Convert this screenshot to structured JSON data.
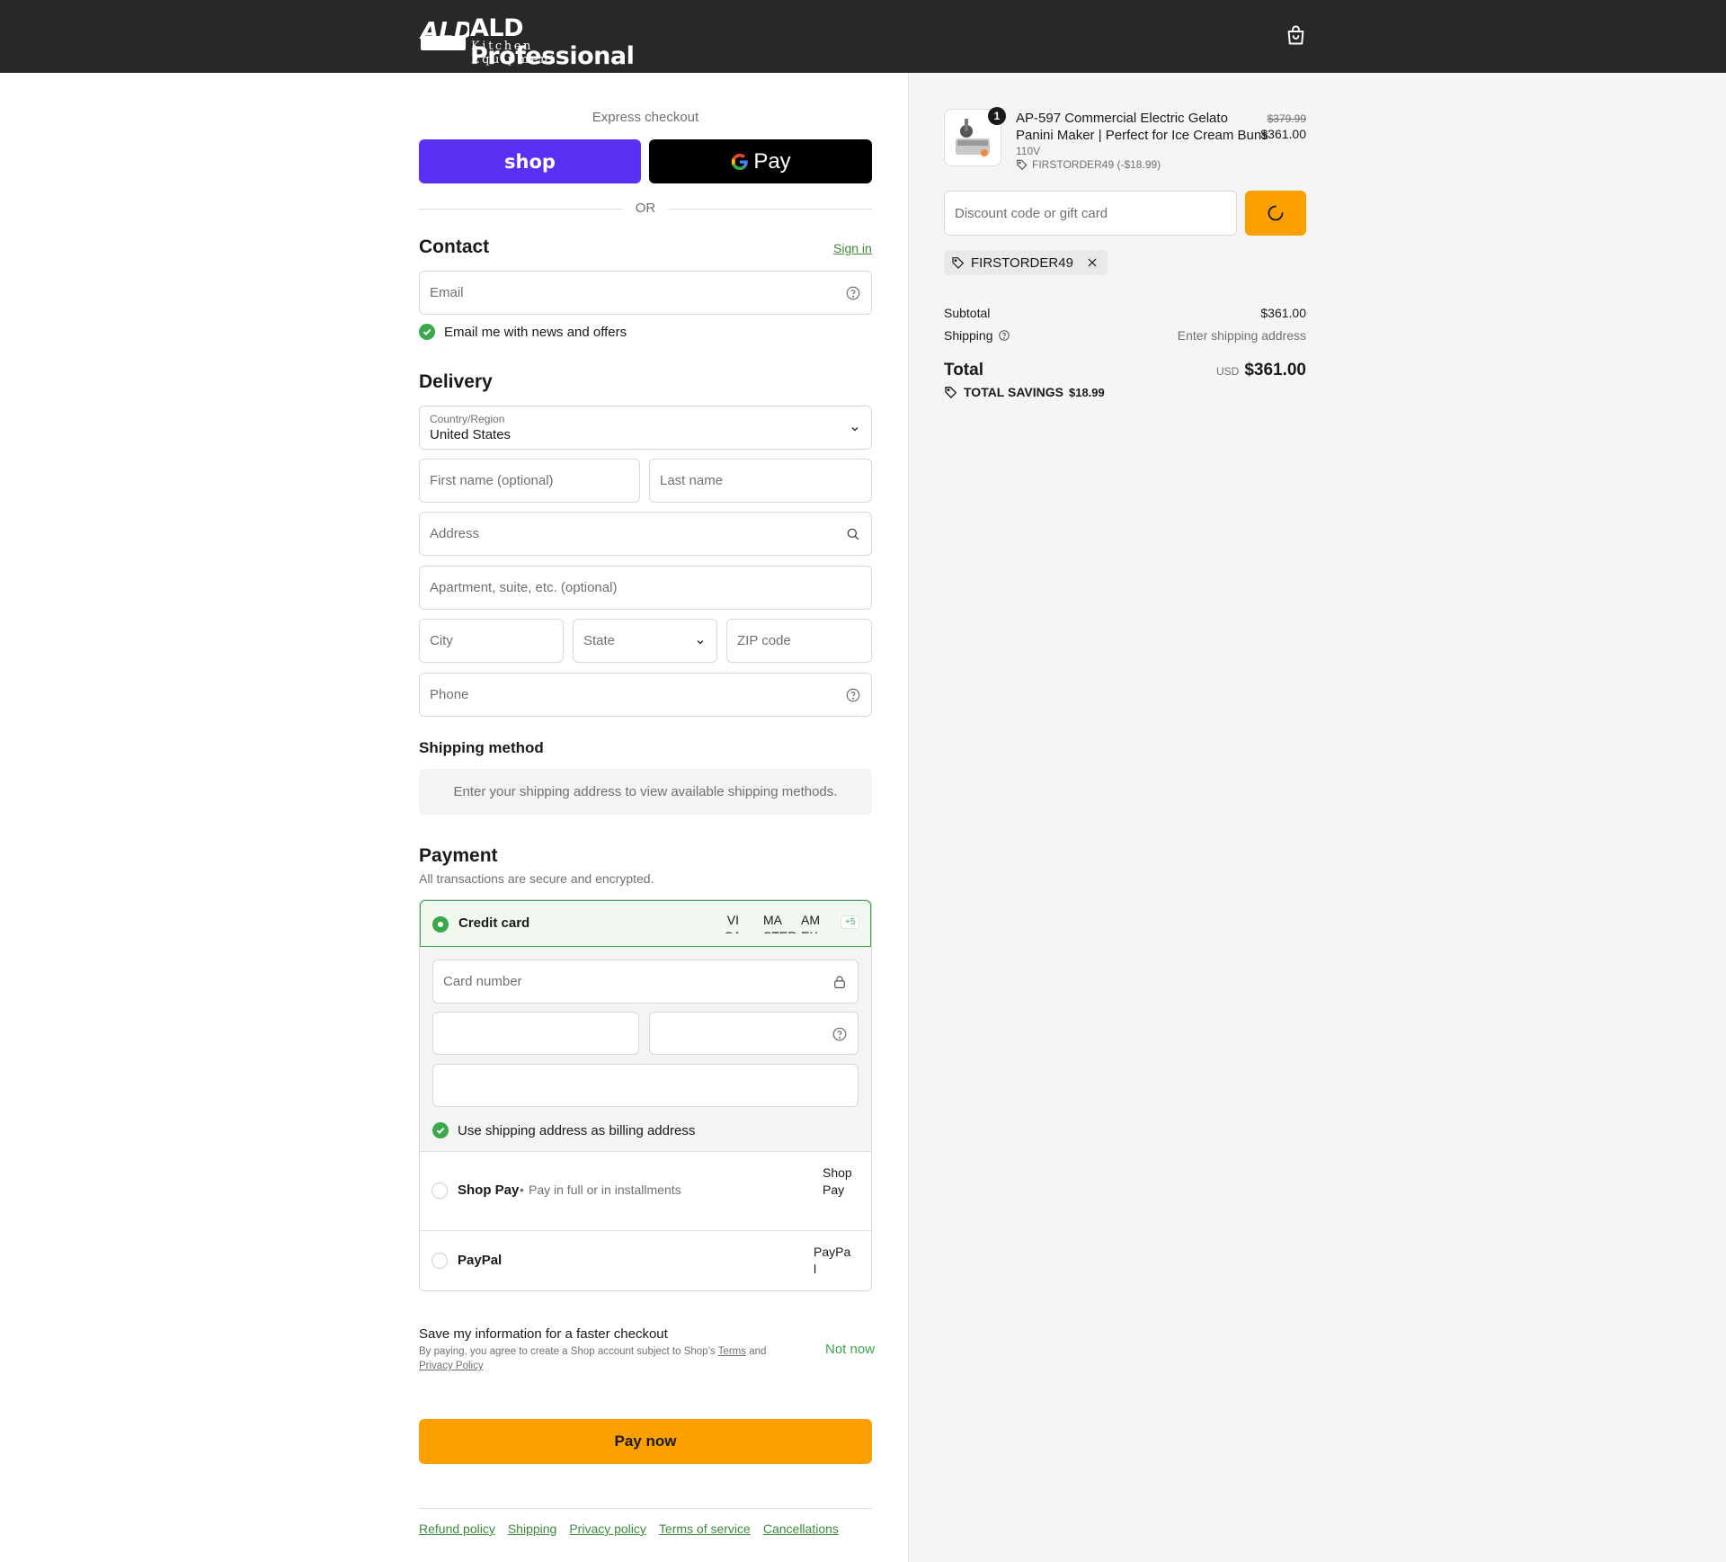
{
  "header": {
    "logo_top": "ALD Professional",
    "logo_mark": "ALD",
    "logo_bottom": "Kitchen Equipment",
    "cart_icon": "shopping-bag-icon"
  },
  "express": {
    "title": "Express checkout",
    "shop_label": "shop",
    "gpay_label": "Pay",
    "or_label": "OR"
  },
  "contact": {
    "title": "Contact",
    "sign_in": "Sign in",
    "email_placeholder": "Email",
    "news_label": "Email me with news and offers"
  },
  "delivery": {
    "title": "Delivery",
    "country_label": "Country/Region",
    "country_value": "United States",
    "first_name_placeholder": "First name (optional)",
    "last_name_placeholder": "Last name",
    "address_placeholder": "Address",
    "apartment_placeholder": "Apartment, suite, etc. (optional)",
    "city_placeholder": "City",
    "state_label": "State",
    "zip_placeholder": "ZIP code",
    "phone_placeholder": "Phone"
  },
  "shipping_method": {
    "title": "Shipping method",
    "notice": "Enter your shipping address to view available shipping methods."
  },
  "payment": {
    "title": "Payment",
    "subtitle": "All transactions are secure and encrypted.",
    "credit_card_label": "Credit card",
    "brand_visa": "VISA",
    "brand_master": "MASTER",
    "brand_amex": "AMEX",
    "brand_visa_alt": " VI SA",
    "brand_master_alt": "MA STER",
    "brand_amex_alt": "AM EX",
    "more_brands": "+5",
    "card_number_placeholder": "Card number",
    "billing_label": "Use shipping address as billing address",
    "shop_pay_label": "Shop Pay",
    "shop_pay_desc": "Pay in full or in installments",
    "shop_pay_alt": "Shop Pay",
    "paypal_label": "PayPal",
    "paypal_alt": "PayPal"
  },
  "save_info": {
    "title": "Save my information for a faster checkout",
    "desc_prefix": "By paying, you agree to create a Shop account subject to Shop’s",
    "terms": "Terms",
    "and": "and",
    "privacy": "Privacy Policy",
    "not_now": "Not now"
  },
  "pay_now": "Pay now",
  "footer_links": [
    "Refund policy",
    "Shipping",
    "Privacy policy",
    "Terms of service",
    "Cancellations"
  ],
  "summary": {
    "quantity": "1",
    "product_name_line1": "AP-597 Commercial Electric Gelato",
    "product_name_line2": "Panini Maker | Perfect for Ice Cream Buns",
    "variant": "110V",
    "product_discount": "FIRSTORDER49 (-$18.99)",
    "original_price": "$379.99",
    "price": "$361.00",
    "discount_placeholder": "Discount code or gift card",
    "applied_code": "FIRSTORDER49",
    "subtotal_label": "Subtotal",
    "subtotal_value": "$361.00",
    "shipping_label": "Shipping",
    "shipping_value": "Enter shipping address",
    "total_label": "Total",
    "currency": "USD",
    "total_value": "$361.00",
    "savings_label": "TOTAL SAVINGS",
    "savings_value": "$18.99"
  },
  "colors": {
    "header_bg": "#2a2826",
    "shop_pay_purple": "#5a31f4",
    "accent_orange": "#fca000",
    "success_green": "#3aa84b",
    "link_green": "#3a8a3a"
  }
}
